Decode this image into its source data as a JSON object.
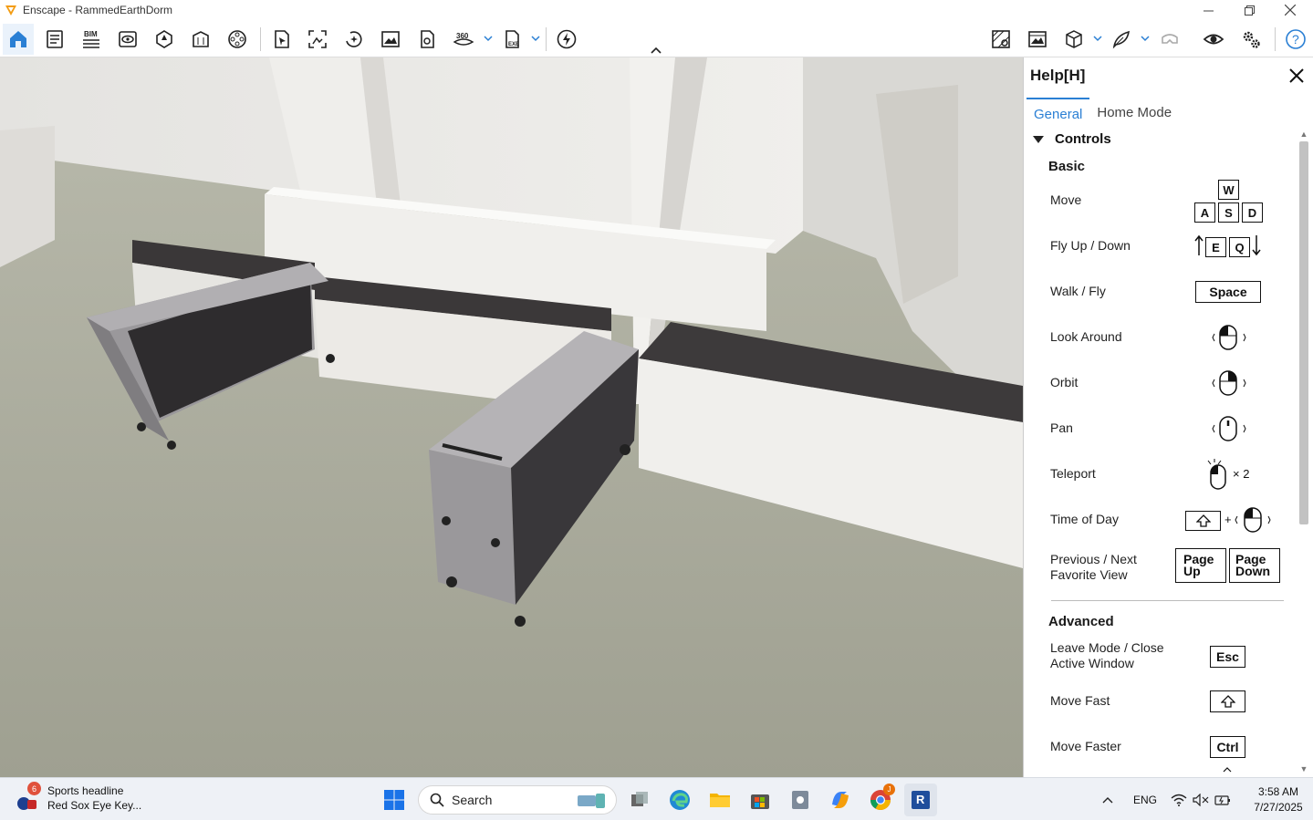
{
  "window": {
    "title": "Enscape - RammedEarthDorm"
  },
  "toolbar": {
    "left_icons": [
      "home-icon",
      "document-settings-icon",
      "bim-icon",
      "eye-view-icon",
      "sun-icon",
      "building-icon",
      "film-reel-icon",
      "cursor-select-icon",
      "capture-area-icon",
      "orbit-sparkle-icon",
      "image-icon",
      "export-icon",
      "panorama-360-icon",
      "exe-export-icon",
      "lightning-icon"
    ],
    "bim_label": "BIM",
    "pano_label": "360",
    "exe_label": "EXE",
    "right_icons": [
      "material-map-icon",
      "render-settings-icon",
      "cube-icon",
      "feather-icon",
      "vr-headset-icon",
      "visibility-icon",
      "settings-gears-icon",
      "help-icon"
    ]
  },
  "help": {
    "title": "Help[H]",
    "tabs": [
      "General",
      "Home Mode"
    ],
    "section": "Controls",
    "basic": {
      "heading": "Basic",
      "move": "Move",
      "fly": "Fly Up / Down",
      "walk": "Walk / Fly",
      "look": "Look Around",
      "orbit": "Orbit",
      "pan": "Pan",
      "teleport": "Teleport",
      "teleport_mult": "× 2",
      "time": "Time of Day",
      "plus": "+",
      "fav_line1": "Previous / Next",
      "fav_line2": "Favorite View"
    },
    "keys": {
      "w": "W",
      "a": "A",
      "s": "S",
      "d": "D",
      "e": "E",
      "q": "Q",
      "space": "Space",
      "pgup1": "Page",
      "pgup2": "Up",
      "pgdn1": "Page",
      "pgdn2": "Down",
      "esc": "Esc",
      "ctrl": "Ctrl"
    },
    "advanced": {
      "heading": "Advanced",
      "leave_line1": "Leave Mode / Close",
      "leave_line2": "Active Window",
      "fast": "Move Fast",
      "faster": "Move Faster"
    }
  },
  "taskbar": {
    "news_badge": "6",
    "news_title": "Sports headline",
    "news_sub": "Red Sox Eye Key...",
    "search": "Search",
    "chrome_badge": "J",
    "lang": "ENG",
    "time": "3:58 AM",
    "date": "7/27/2025"
  },
  "colors": {
    "accent": "#2a7fd4",
    "floor": "#a8a999",
    "wall": "#ecebe8",
    "cart": "#8d8a8f"
  }
}
